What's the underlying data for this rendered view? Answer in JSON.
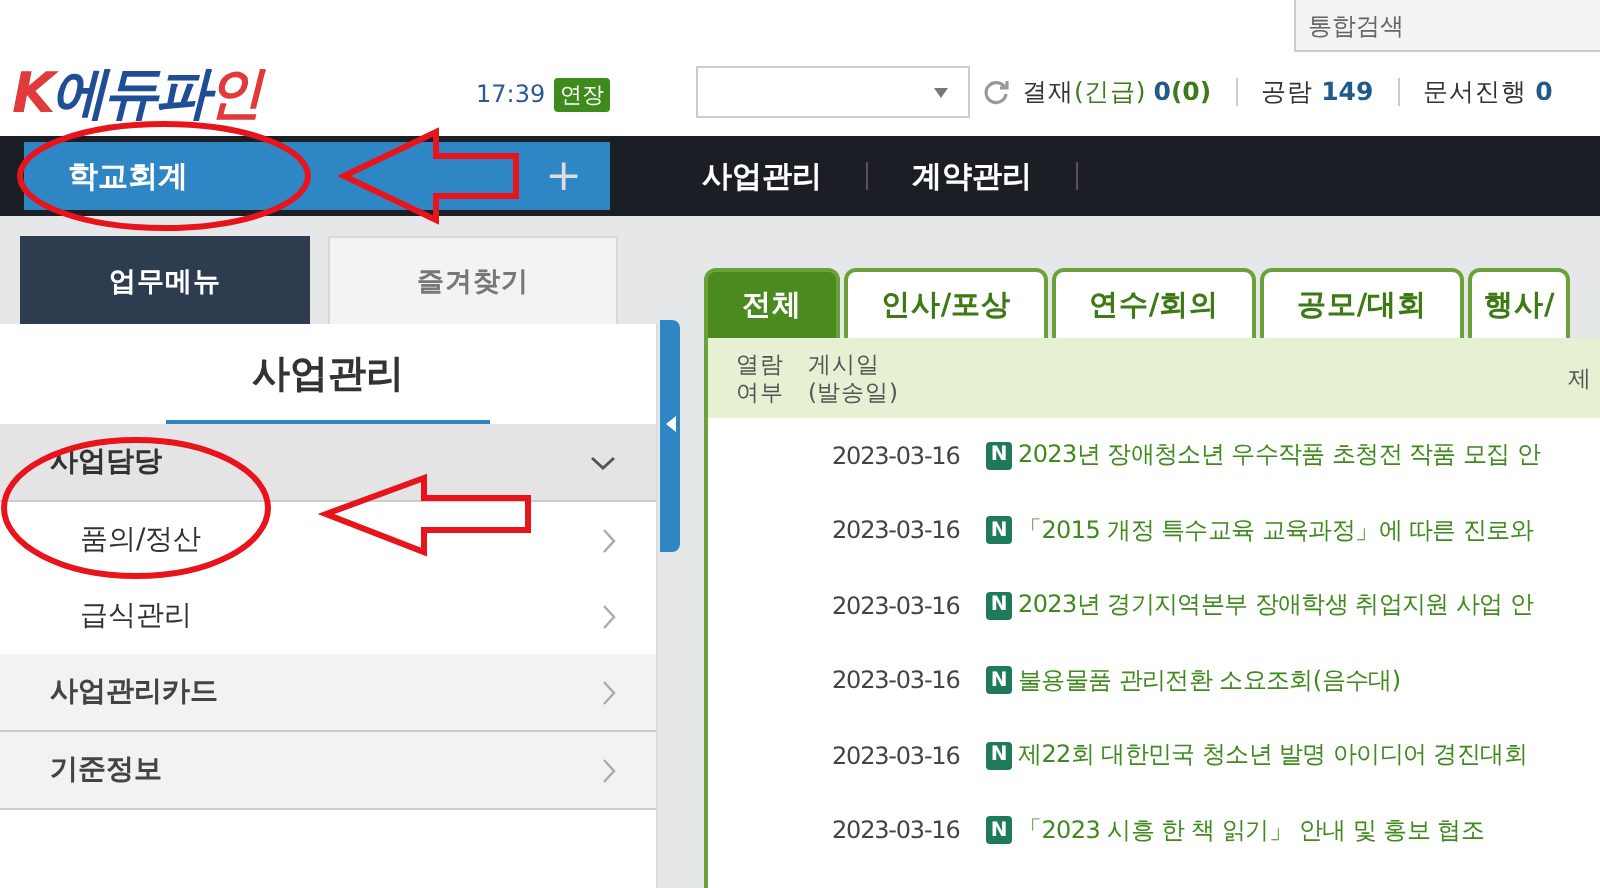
{
  "header": {
    "logo": {
      "mark": "K",
      "name": "에듀파",
      "tail": "인"
    },
    "time": "17:39",
    "extend_badge": "연장",
    "search": {
      "placeholder": "통합검색"
    },
    "status": [
      {
        "label": "결재",
        "sub": "(긴급)",
        "count": "0",
        "sub_count": "(0)"
      },
      {
        "label": "공람",
        "count": "149"
      },
      {
        "label": "문서진행",
        "count": "0"
      }
    ]
  },
  "nav": {
    "system": "학교회계",
    "add_icon": "+",
    "items": [
      {
        "label": "사업관리",
        "selected": false
      },
      {
        "label": "계약관리",
        "selected": false
      }
    ]
  },
  "side_tabs": [
    {
      "label": "업무메뉴",
      "selected": true
    },
    {
      "label": "즐겨찾기",
      "selected": false
    }
  ],
  "side_menu": {
    "title": "사업관리",
    "items": [
      {
        "label": "사업담당",
        "expanded": true,
        "children": [
          {
            "label": "품의/정산"
          },
          {
            "label": "급식관리"
          }
        ]
      },
      {
        "label": "사업관리카드",
        "expanded": false
      },
      {
        "label": "기준정보",
        "expanded": false
      }
    ]
  },
  "board": {
    "tabs": [
      {
        "label": "전체",
        "selected": true
      },
      {
        "label": "인사/포상",
        "selected": false
      },
      {
        "label": "연수/회의",
        "selected": false
      },
      {
        "label": "공모/대회",
        "selected": false
      },
      {
        "label": "행사/",
        "selected": false
      }
    ],
    "columns": [
      "열람\n여부",
      "게시일\n(발송일)",
      "제"
    ],
    "rows": [
      {
        "date": "2023-03-16",
        "badge": "N",
        "title": "2023년 장애청소년 우수작품 초청전 작품 모집 안"
      },
      {
        "date": "2023-03-16",
        "badge": "N",
        "title": "「2015 개정 특수교육 교육과정」에 따른 진로와"
      },
      {
        "date": "2023-03-16",
        "badge": "N",
        "title": "2023년 경기지역본부 장애학생 취업지원 사업 안"
      },
      {
        "date": "2023-03-16",
        "badge": "N",
        "title": "불용물품 관리전환 소요조회(음수대)"
      },
      {
        "date": "2023-03-16",
        "badge": "N",
        "title": "제22회 대한민국 청소년 발명 아이디어 경진대회"
      },
      {
        "date": "2023-03-16",
        "badge": "N",
        "title": "「2023 시흥 한 책 읽기」 안내 및 홍보 협조"
      }
    ]
  }
}
